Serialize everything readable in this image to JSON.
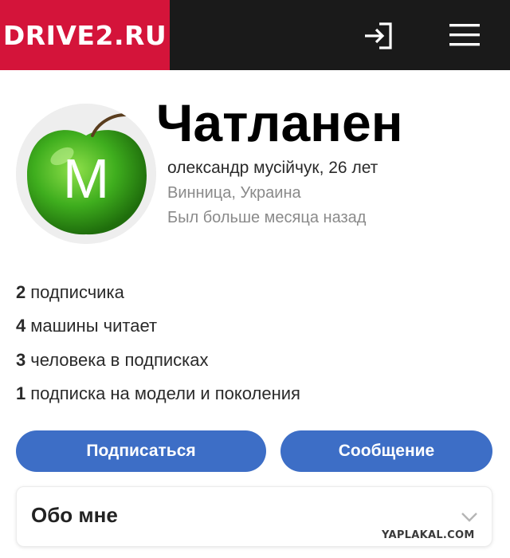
{
  "header": {
    "logo_text": "DRIVE2.RU",
    "login_icon": "sign-in-icon",
    "menu_icon": "hamburger-menu-icon",
    "colors": {
      "brand": "#d4143a",
      "bar": "#1a1a1a"
    }
  },
  "overlay": {
    "title": "Чатланен"
  },
  "profile": {
    "avatar_letter": "M",
    "name_age": "олександр мусійчук, 26 лет",
    "location": "Винница, Украина",
    "last_seen": "Был больше месяца назад"
  },
  "stats": [
    {
      "count": "2",
      "label": "подписчика"
    },
    {
      "count": "4",
      "label": "машины читает"
    },
    {
      "count": "3",
      "label": "человека в подписках"
    },
    {
      "count": "1",
      "label": "подписка на модели и поколения"
    }
  ],
  "actions": {
    "subscribe_label": "Подписаться",
    "message_label": "Сообщение",
    "accent": "#3d6ec6"
  },
  "about": {
    "title": "Обо мне",
    "icon": "chevron-down-icon"
  },
  "watermark": "YAPLAKAL.COM"
}
